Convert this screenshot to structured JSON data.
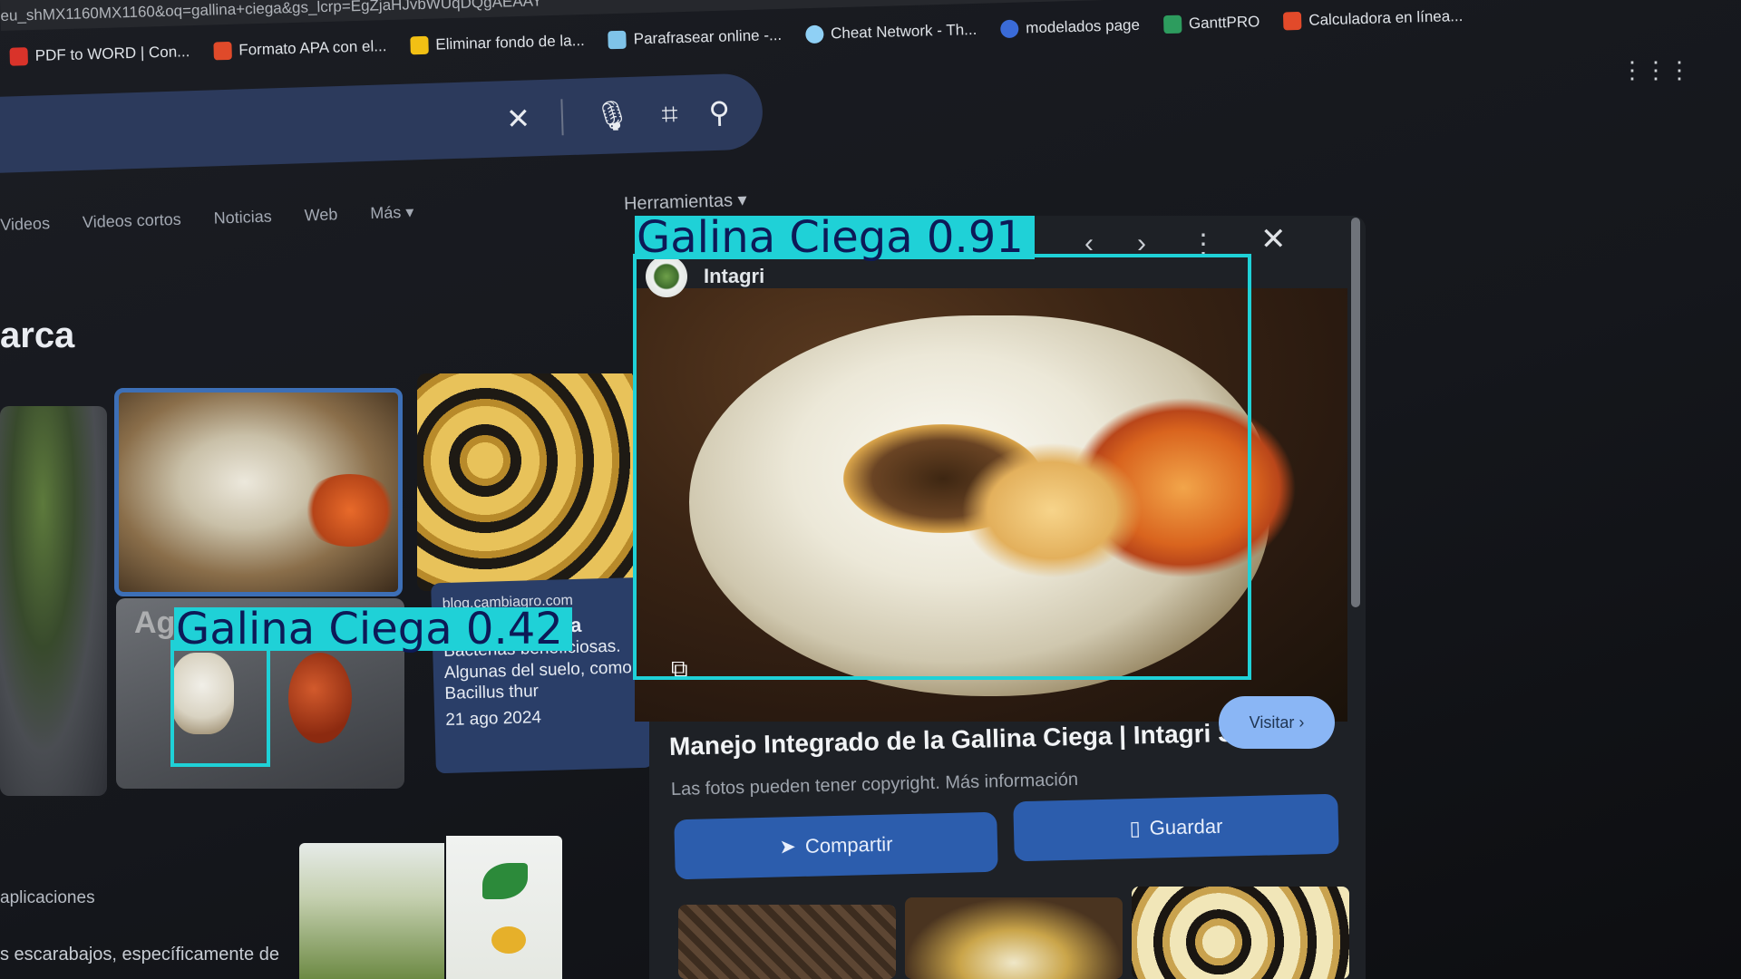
{
  "browser": {
    "url_fragment": "eu_shMX1160MX1160&oq=gallina+ciega&gs_lcrp=EgZjaHJvbWUqDQgAEAAY",
    "bookmarks": [
      {
        "label": "PDF to WORD | Con...",
        "color": "#d9332a"
      },
      {
        "label": "Formato APA con el...",
        "color": "#e04a2a"
      },
      {
        "label": "Eliminar fondo de la...",
        "color": "#f2c014"
      },
      {
        "label": "Parafrasear online -...",
        "color": "#7fc3e8"
      },
      {
        "label": "Cheat Network - Th...",
        "color": "#8fd0f5"
      },
      {
        "label": "modelados page",
        "color": "#3a6bd8"
      },
      {
        "label": "GanttPRO",
        "color": "#2d9c5e"
      },
      {
        "label": "Calculadora en línea...",
        "color": "#e24a2a"
      }
    ],
    "apps_icon": "apps-grid-icon"
  },
  "search": {
    "clear_icon": "✕",
    "mic_icon": "🎙",
    "lens_icon": "⌗",
    "search_icon": "⚲"
  },
  "filters": {
    "tabs": [
      "Videos",
      "Videos cortos",
      "Noticias",
      "Web",
      "Más ▾"
    ],
    "tools_label": "Herramientas ▾"
  },
  "results": {
    "heading": "arca",
    "card": {
      "source": "blog.cambiagro.com",
      "title": "Ciega En Papa",
      "snippet": "Bacterias beneficiosas. Algunas del suelo, como Bacillus thur",
      "date": "21 ago 2024"
    },
    "stone_caption": "Agavel",
    "bottom_text_1": "aplicaciones",
    "bottom_text_2": "s escarabajos, específicamente de"
  },
  "preview": {
    "source_name": "Intagri",
    "title": "Manejo Integrado de la Gallina Ciega | Intagri S.C.",
    "visit_label": "Visitar ›",
    "copyright": "Las fotos pueden tener copyright. Más información",
    "share_label": "Compartir",
    "save_label": "Guardar",
    "nav_prev": "‹",
    "nav_next": "›",
    "more": "⋮",
    "close": "✕"
  },
  "detections": [
    {
      "label": "Galina Ciega 0.91",
      "class": "Galina Ciega",
      "score": 0.91
    },
    {
      "label": "Galina Ciega 0.42",
      "class": "Galina Ciega",
      "score": 0.42
    }
  ],
  "colors": {
    "detection": "#1fd1d7",
    "detection_text": "#0d1a57",
    "button_blue": "#2c5dad",
    "visit_button": "#8ab6f5"
  }
}
